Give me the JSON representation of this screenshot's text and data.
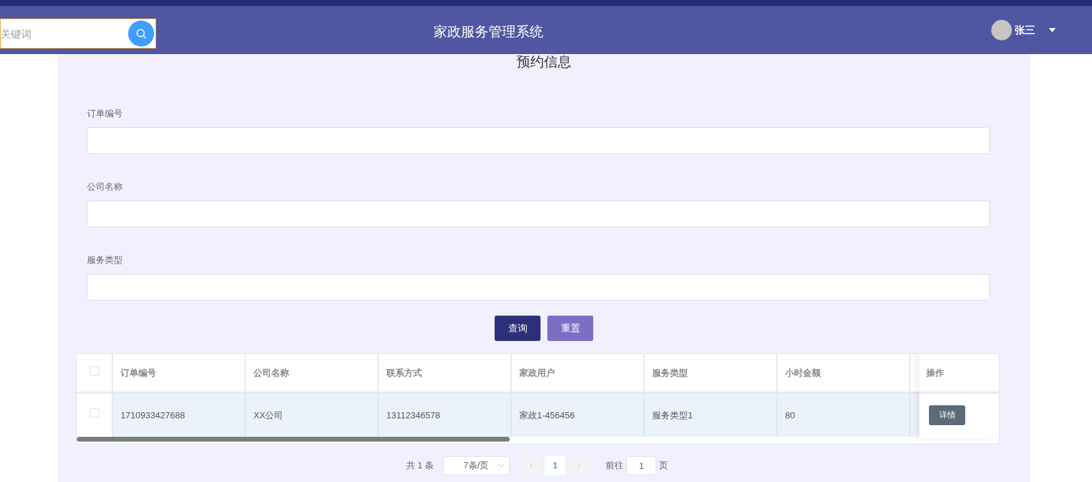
{
  "header": {
    "search": {
      "placeholder": "关键词"
    },
    "title": "家政服务管理系统",
    "user": {
      "name": "张三"
    }
  },
  "page_title": "预约信息",
  "filters": [
    {
      "label": "订单编号"
    },
    {
      "label": "公司名称"
    },
    {
      "label": "服务类型"
    }
  ],
  "buttons": [
    {
      "label": "查询",
      "kind": "primary"
    },
    {
      "label": "重置",
      "kind": "secondary"
    }
  ],
  "table": {
    "select_all": {
      "checked": false
    },
    "columns": [
      "订单编号",
      "公司名称",
      "联系方式",
      "家政用户",
      "服务类型",
      "小时金额"
    ],
    "action_column": "操作",
    "rows": [
      {
        "checked": false,
        "cells": [
          "1710933427688",
          "XX公司",
          "13112346578",
          "家政1-456456",
          "服务类型1",
          "80"
        ],
        "action": "详情"
      }
    ]
  },
  "pagination": {
    "total": "共 1 条",
    "page_size": "7条/页",
    "pages": [
      {
        "label": "1",
        "selected": true
      }
    ],
    "goto_label": "前往",
    "goto_value": "1",
    "goto_suffix": "页"
  }
}
